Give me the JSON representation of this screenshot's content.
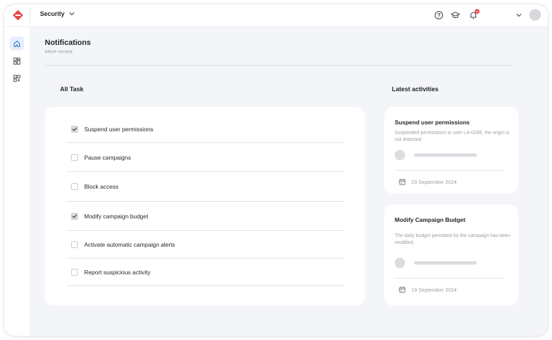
{
  "topbar": {
    "workspace_label": "Security",
    "notification_count": "6"
  },
  "page": {
    "title": "Notifications",
    "subtitle": "More recent"
  },
  "tasks": {
    "title": "All Task",
    "items": [
      {
        "label": "Suspend user permissions",
        "checked": true
      },
      {
        "label": "Pause campaigns",
        "checked": false
      },
      {
        "label": "Block access",
        "checked": false
      },
      {
        "label": "Modify campaign budget",
        "checked": true
      },
      {
        "label": "Activate automatic campaign alerts",
        "checked": false
      },
      {
        "label": "Report suspicious activity",
        "checked": false
      }
    ]
  },
  "activities": {
    "title": "Latest activities",
    "items": [
      {
        "title": "Suspend user permissions",
        "description": "Suspended permissions to user LA-0186, the origin is not detected",
        "date": "23 September 2024"
      },
      {
        "title": "Modify Campaign Budget",
        "description": "The daily budget permitted for the campaign has been modified.",
        "date": "19 September 2024"
      }
    ]
  },
  "colors": {
    "accent": "#2f6fd6",
    "brand": "#e5484d",
    "background": "#f4f5f8"
  }
}
